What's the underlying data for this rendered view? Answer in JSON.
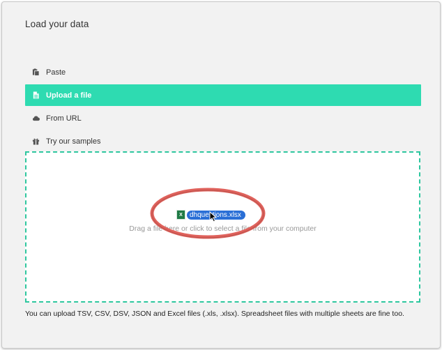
{
  "header": {
    "title": "Load your data"
  },
  "menu": {
    "items": [
      {
        "label": "Paste",
        "icon": "paste-icon",
        "active": false
      },
      {
        "label": "Upload a file",
        "icon": "file-icon",
        "active": true
      },
      {
        "label": "From URL",
        "icon": "cloud-icon",
        "active": false
      },
      {
        "label": "Try our samples",
        "icon": "gift-icon",
        "active": false
      }
    ]
  },
  "dropzone": {
    "instruction": "Drag a file here or click to select a file from your computer",
    "dragged_file": "dhquestions.xlsx",
    "file_icon": "excel-file-icon"
  },
  "footnote": "You can upload TSV, CSV, DSV, JSON and Excel files (.xls, .xlsx). Spreadsheet files with multiple sheets are fine too.",
  "colors": {
    "accent": "#2edbb1",
    "dropzone_border": "#2ec79f",
    "annotation_ring": "#e0625c",
    "file_chip": "#2a6fd6"
  }
}
